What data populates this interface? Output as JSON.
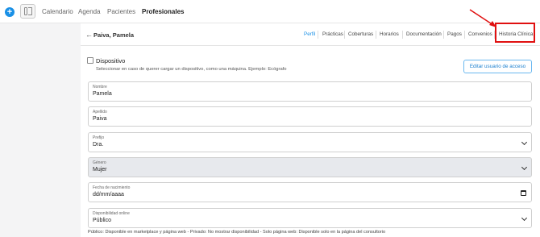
{
  "topnav": {
    "add_symbol": "+",
    "links": [
      "Calendario",
      "Agenda",
      "Pacientes",
      "Profesionales"
    ],
    "active": "Profesionales"
  },
  "header": {
    "back_symbol": "←",
    "name": "Paiva, Pamela",
    "tabs": [
      "Perfil",
      "Prácticas",
      "Coberturas",
      "Horarios",
      "Documentación",
      "Pagos",
      "Convenios",
      "Historia Clínica"
    ],
    "active_tab": "Perfil",
    "highlighted_tab": "Historia Clínica"
  },
  "device": {
    "label": "Dispositivo",
    "help": "Seleccionar en caso de querer cargar un dispositivo, como una máquina. Ejemplo: Ecógrafo",
    "checked": false
  },
  "edit_user_button": "Editar usuario de acceso",
  "fields": {
    "nombre": {
      "label": "Nombre",
      "value": "Pamela"
    },
    "apellido": {
      "label": "Apellido",
      "value": "Paiva"
    },
    "prefijo": {
      "label": "Prefijo",
      "value": "Dra."
    },
    "genero": {
      "label": "Género",
      "value": "Mujer"
    },
    "fecha": {
      "label": "Fecha de nacimiento",
      "value": "dd/mm/aaaa"
    },
    "disponibilidad": {
      "label": "Disponibilidad online",
      "value": "Público"
    }
  },
  "availability_help": "Público: Disponible en marketplace y página web - Privado: No mostrar disponibilidad - Solo página web: Disponible solo en la página del consultorio",
  "colors": {
    "accent": "#1a90e6",
    "highlight": "#e01010"
  }
}
